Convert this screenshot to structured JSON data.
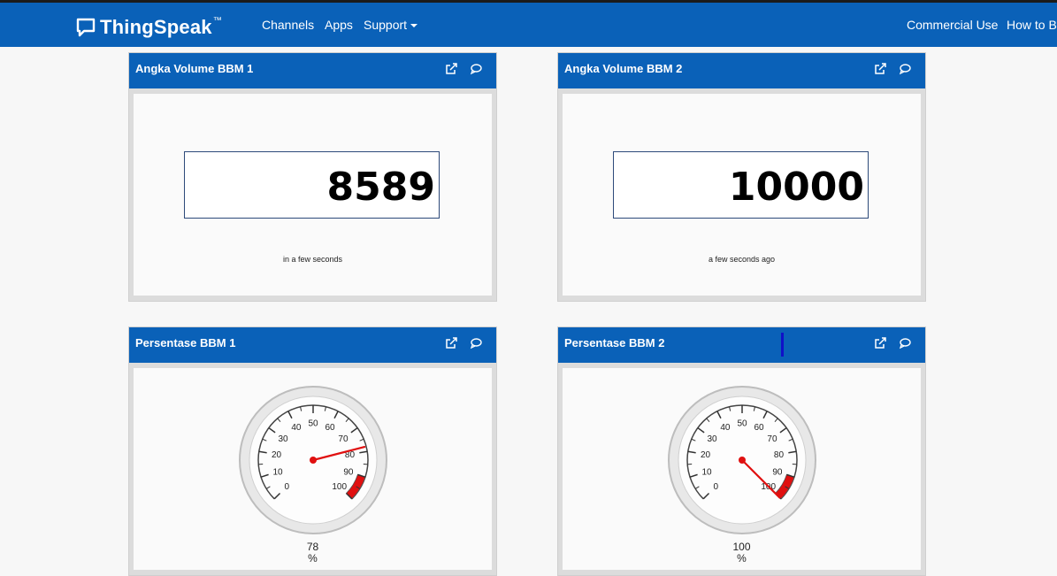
{
  "navbar": {
    "brand": "ThingSpeak",
    "brand_tm": "™",
    "menu": [
      "Channels",
      "Apps",
      "Support"
    ],
    "right_links": [
      "Commercial Use",
      "How to Bu"
    ]
  },
  "widgets": {
    "numeric": [
      {
        "title": "Angka Volume BBM 1",
        "value": "8589",
        "timestamp": "in a few seconds"
      },
      {
        "title": "Angka Volume BBM 2",
        "value": "10000",
        "timestamp": "a few seconds ago"
      }
    ],
    "gauges": [
      {
        "title": "Persentase BBM 1",
        "value": "78",
        "unit": "%",
        "reading": 78
      },
      {
        "title": "Persentase BBM 2",
        "value": "100",
        "unit": "%",
        "reading": 100
      }
    ],
    "gauge_ticks": [
      "0",
      "10",
      "20",
      "30",
      "40",
      "50",
      "60",
      "70",
      "80",
      "90",
      "100"
    ],
    "gauge_scale": [
      0,
      100
    ],
    "gauge_danger_band": [
      90,
      100
    ]
  },
  "icons": [
    "speech-bubble-icon",
    "caret-down-icon",
    "external-link-icon",
    "comment-icon"
  ],
  "colors": {
    "brand_blue": "#0a61b8",
    "needle": "#e01010",
    "band": "#e01010"
  }
}
